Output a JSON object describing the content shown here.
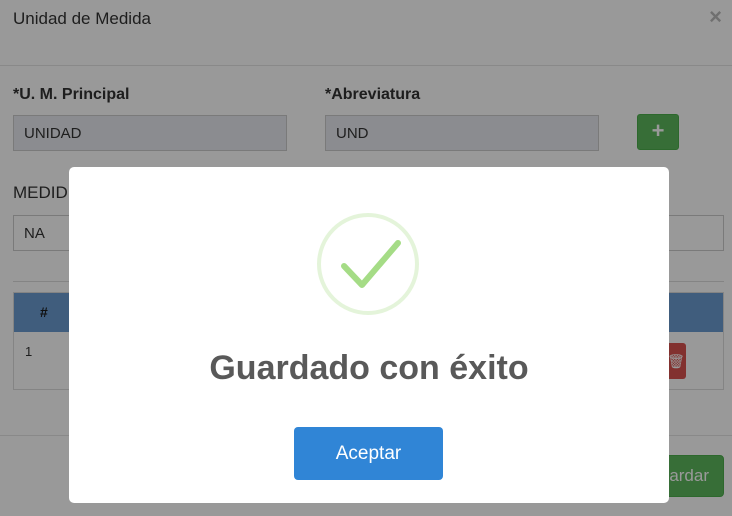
{
  "background_modal": {
    "title": "Unidad de Medida",
    "close_symbol": "×",
    "fields": {
      "principal_label": "*U. M. Principal",
      "principal_value": "UNIDAD",
      "abreviatura_label": "*Abreviatura",
      "abreviatura_value": "UND",
      "add_symbol": "+",
      "medida_label": "MEDID",
      "medida_value": "NA"
    },
    "table": {
      "header_num": "#",
      "rows": [
        {
          "num": "1"
        }
      ]
    },
    "save_label": "ardar"
  },
  "dialog": {
    "icon": "success-check-icon",
    "title": "Guardado con éxito",
    "confirm_label": "Aceptar",
    "colors": {
      "confirm": "#3085d6",
      "check": "#a5dc86",
      "title": "#595959"
    }
  }
}
